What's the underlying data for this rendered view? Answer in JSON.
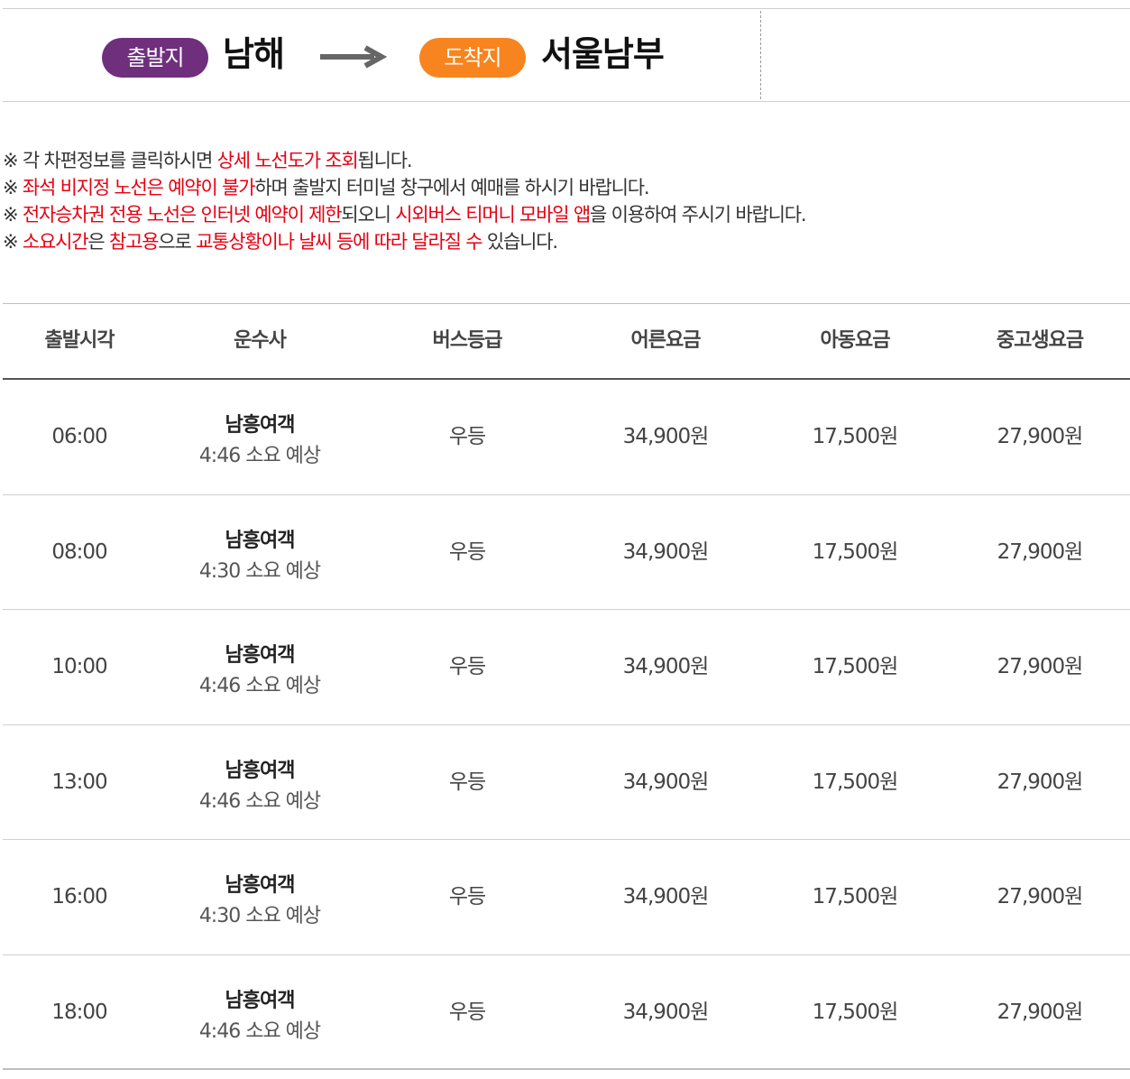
{
  "route": {
    "depart_label": "출발지",
    "depart_city": "남해",
    "arrive_label": "도착지",
    "arrive_city": "서울남부",
    "depart_color": "#6f2f7d",
    "arrive_color": "#f7841f"
  },
  "notices": [
    [
      {
        "t": "※ 각 차편정보를 클릭하시면 ",
        "hl": false
      },
      {
        "t": "상세 노선도가 조회",
        "hl": true
      },
      {
        "t": "됩니다.",
        "hl": false
      }
    ],
    [
      {
        "t": "※ ",
        "hl": false
      },
      {
        "t": "좌석 비지정 노선은 예약이 불가",
        "hl": true
      },
      {
        "t": "하며 출발지 터미널 창구에서 예매를 하시기 바랍니다.",
        "hl": false
      }
    ],
    [
      {
        "t": "※ ",
        "hl": false
      },
      {
        "t": "전자승차권 전용 노선은 인터넷 예약이 제한",
        "hl": true
      },
      {
        "t": "되오니 ",
        "hl": false
      },
      {
        "t": "시외버스 티머니 모바일 앱",
        "hl": true
      },
      {
        "t": "을 이용하여 주시기 바랍니다.",
        "hl": false
      }
    ],
    [
      {
        "t": "※ ",
        "hl": false
      },
      {
        "t": "소요시간",
        "hl": true
      },
      {
        "t": "은 ",
        "hl": false
      },
      {
        "t": "참고용",
        "hl": true
      },
      {
        "t": "으로 ",
        "hl": false
      },
      {
        "t": "교통상황이나 날씨 등에 따라 달라질 수",
        "hl": true
      },
      {
        "t": " 있습니다.",
        "hl": false
      }
    ]
  ],
  "highlight_color": "#e60012",
  "table": {
    "headers": {
      "time": "출발시각",
      "company": "운수사",
      "grade": "버스등급",
      "adult": "어른요금",
      "child": "아동요금",
      "student": "중고생요금"
    },
    "rows": [
      {
        "time": "06:00",
        "company": "남흥여객",
        "duration": "4:46 소요 예상",
        "grade": "우등",
        "adult": "34,900원",
        "child": "17,500원",
        "student": "27,900원"
      },
      {
        "time": "08:00",
        "company": "남흥여객",
        "duration": "4:30 소요 예상",
        "grade": "우등",
        "adult": "34,900원",
        "child": "17,500원",
        "student": "27,900원"
      },
      {
        "time": "10:00",
        "company": "남흥여객",
        "duration": "4:46 소요 예상",
        "grade": "우등",
        "adult": "34,900원",
        "child": "17,500원",
        "student": "27,900원"
      },
      {
        "time": "13:00",
        "company": "남흥여객",
        "duration": "4:46 소요 예상",
        "grade": "우등",
        "adult": "34,900원",
        "child": "17,500원",
        "student": "27,900원"
      },
      {
        "time": "16:00",
        "company": "남흥여객",
        "duration": "4:30 소요 예상",
        "grade": "우등",
        "adult": "34,900원",
        "child": "17,500원",
        "student": "27,900원"
      },
      {
        "time": "18:00",
        "company": "남흥여객",
        "duration": "4:46 소요 예상",
        "grade": "우등",
        "adult": "34,900원",
        "child": "17,500원",
        "student": "27,900원"
      }
    ]
  }
}
